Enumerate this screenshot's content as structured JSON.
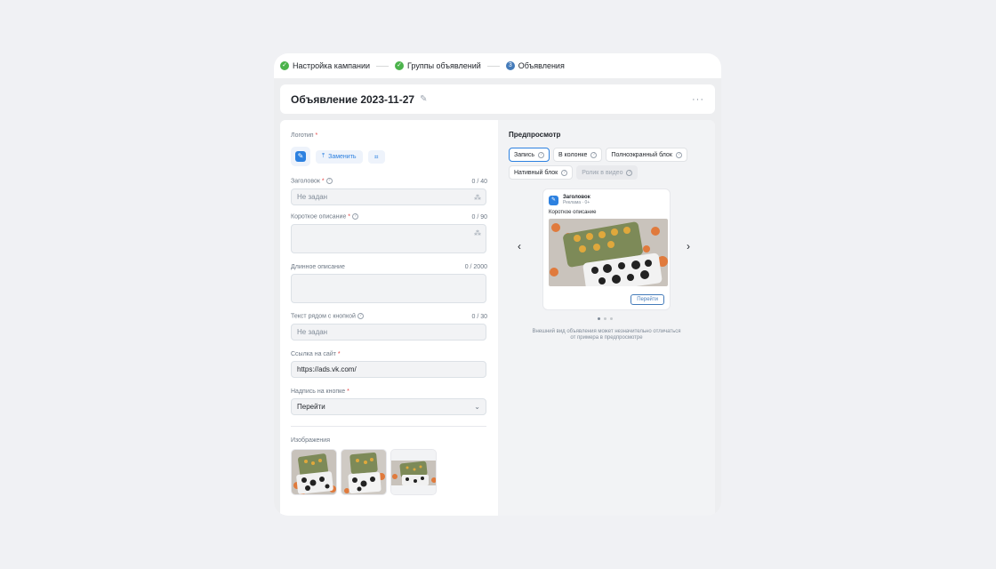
{
  "stepper": {
    "steps": [
      {
        "label": "Настройка кампании",
        "state": "done"
      },
      {
        "label": "Группы объявлений",
        "state": "done"
      },
      {
        "label": "Объявления",
        "state": "current",
        "number": "3"
      }
    ]
  },
  "header": {
    "title": "Объявление 2023-11-27",
    "more": "···"
  },
  "form": {
    "logo": {
      "label": "Логотип",
      "replace_label": "Заменить"
    },
    "title_field": {
      "label": "Заголовок",
      "counter": "0 / 40",
      "placeholder": "Не задан"
    },
    "short_desc": {
      "label": "Короткое описание",
      "counter": "0 / 90"
    },
    "long_desc": {
      "label": "Длинное описание",
      "counter": "0 / 2000"
    },
    "button_text": {
      "label": "Текст рядом с кнопкой",
      "counter": "0 / 30",
      "placeholder": "Не задан"
    },
    "site_link": {
      "label": "Ссылка на сайт",
      "value": "https://ads.vk.com/"
    },
    "button_caption": {
      "label": "Надпись на кнопке",
      "value": "Перейти"
    },
    "images": {
      "label": "Изображения"
    }
  },
  "preview": {
    "title": "Предпросмотр",
    "tabs": [
      {
        "label": "Запись",
        "state": "active"
      },
      {
        "label": "В колонке",
        "state": "normal"
      },
      {
        "label": "Полноэкранный блок",
        "state": "normal"
      },
      {
        "label": "Нативный блок",
        "state": "normal"
      },
      {
        "label": "Ролик в видео",
        "state": "disabled"
      }
    ],
    "card": {
      "name": "Заголовок",
      "subtitle": "Реклама · 0+",
      "description": "Короткое описание",
      "button": "Перейти"
    },
    "carousel_pages": 3,
    "carousel_current": 1,
    "note": "Внешний вид объявления может незначительно отличаться от примера в предпросмотре"
  },
  "colors": {
    "accent": "#2d81e0",
    "success": "#4bb34b",
    "step_current": "#447bba"
  }
}
